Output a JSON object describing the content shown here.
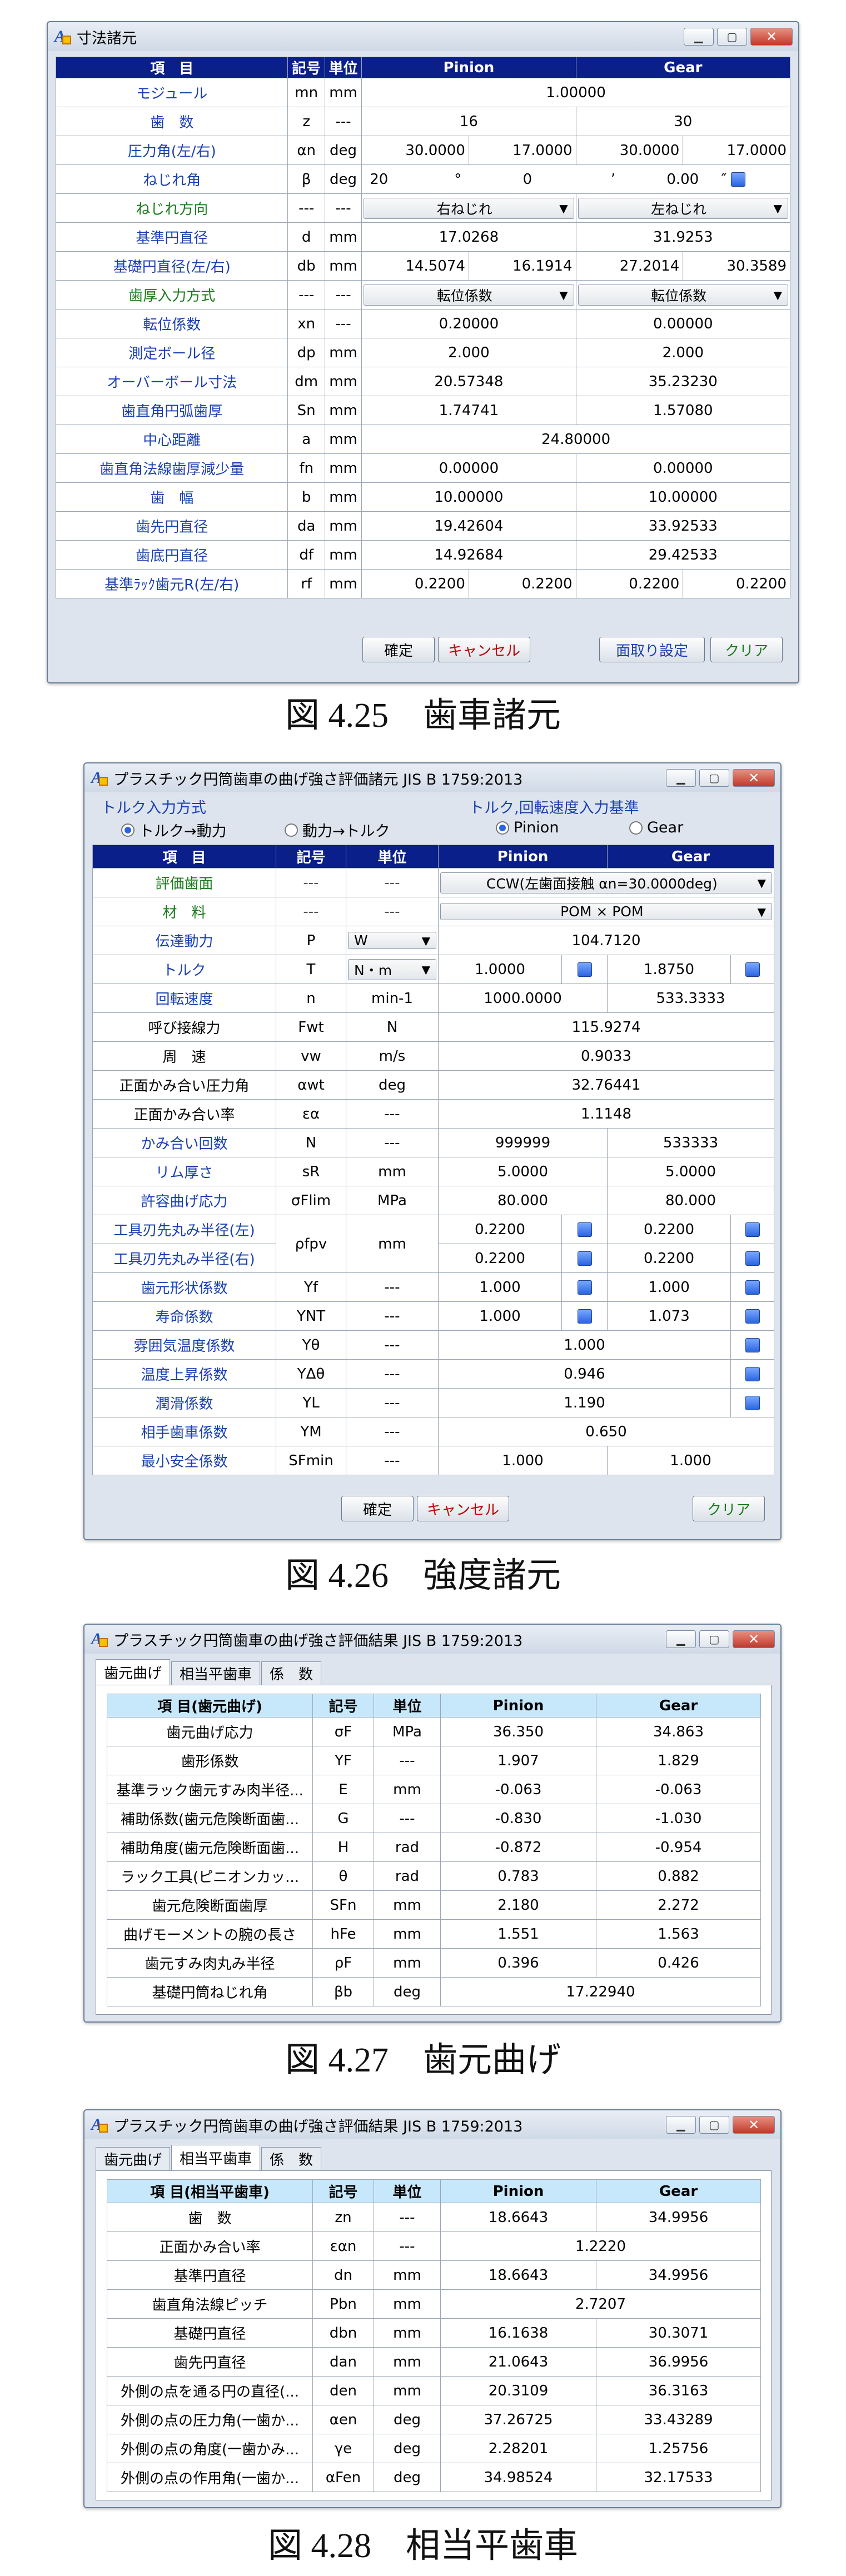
{
  "fig1": {
    "title": "寸法諸元",
    "headers": [
      "項　目",
      "記号",
      "単位",
      "Pinion",
      "Gear"
    ],
    "rows": [
      {
        "label": "モジュール",
        "sym": "mn",
        "unit": "mm",
        "span": "1.00000"
      },
      {
        "label": "歯　数",
        "sym": "z",
        "unit": "---",
        "p": "16",
        "g": "30"
      },
      {
        "label": "圧力角(左/右)",
        "sym": "αn",
        "unit": "deg",
        "p1": "30.0000",
        "p2": "17.0000",
        "g1": "30.0000",
        "g2": "17.0000"
      },
      {
        "label": "ねじれ角",
        "sym": "β",
        "unit": "deg",
        "deg": "20",
        "degmark": "°",
        "min": "0",
        "minmark": "’",
        "sec": "0.00",
        "secmark": "″"
      },
      {
        "label": "ねじれ方向",
        "sym": "---",
        "unit": "---",
        "p": "右ねじれ",
        "g": "左ねじれ"
      },
      {
        "label": "基準円直径",
        "sym": "d",
        "unit": "mm",
        "p": "17.0268",
        "g": "31.9253"
      },
      {
        "label": "基礎円直径(左/右)",
        "sym": "db",
        "unit": "mm",
        "p1": "14.5074",
        "p2": "16.1914",
        "g1": "27.2014",
        "g2": "30.3589"
      },
      {
        "label": "歯厚入力方式",
        "sym": "---",
        "unit": "---",
        "p": "転位係数",
        "g": "転位係数"
      },
      {
        "label": "転位係数",
        "sym": "xn",
        "unit": "---",
        "p": "0.20000",
        "g": "0.00000"
      },
      {
        "label": "測定ボール径",
        "sym": "dp",
        "unit": "mm",
        "p": "2.000",
        "g": "2.000"
      },
      {
        "label": "オーバーボール寸法",
        "sym": "dm",
        "unit": "mm",
        "p": "20.57348",
        "g": "35.23230"
      },
      {
        "label": "歯直角円弧歯厚",
        "sym": "Sn",
        "unit": "mm",
        "p": "1.74741",
        "g": "1.57080"
      },
      {
        "label": "中心距離",
        "sym": "a",
        "unit": "mm",
        "span": "24.80000"
      },
      {
        "label": "歯直角法線歯厚減少量",
        "sym": "fn",
        "unit": "mm",
        "p": "0.00000",
        "g": "0.00000"
      },
      {
        "label": "歯　幅",
        "sym": "b",
        "unit": "mm",
        "p": "10.00000",
        "g": "10.00000"
      },
      {
        "label": "歯先円直径",
        "sym": "da",
        "unit": "mm",
        "p": "19.42604",
        "g": "33.92533"
      },
      {
        "label": "歯底円直径",
        "sym": "df",
        "unit": "mm",
        "p": "14.92684",
        "g": "29.42533"
      },
      {
        "label": "基準ﾗｯｸ歯元R(左/右)",
        "sym": "rf",
        "unit": "mm",
        "p1": "0.2200",
        "p2": "0.2200",
        "g1": "0.2200",
        "g2": "0.2200"
      }
    ],
    "btn_ok": "確定",
    "btn_cancel": "キャンセル",
    "btn_chamfer": "面取り設定",
    "btn_clear": "クリア",
    "caption": "図 4.25　歯車諸元"
  },
  "fig2": {
    "title": "プラスチック円筒歯車の曲げ強さ評価諸元 JIS B 1759:2013",
    "group1": "トルク入力方式",
    "r1a": "トルク→動力",
    "r1b": "動力→トルク",
    "group2": "トルク,回転速度入力基準",
    "r2a": "Pinion",
    "r2b": "Gear",
    "headers": [
      "項　目",
      "記号",
      "単位",
      "Pinion",
      "Gear"
    ],
    "rows": [
      {
        "label": "評価歯面",
        "sym": "---",
        "unit": "---",
        "span": "CCW(左歯面接触 αn=30.0000deg)"
      },
      {
        "label": "材　料",
        "sym": "---",
        "unit": "---",
        "span": "POM × POM"
      },
      {
        "label": "伝達動力",
        "sym": "P",
        "unit": "W",
        "span": "104.7120"
      },
      {
        "label": "トルク",
        "sym": "T",
        "unit": "N・m",
        "p": "1.0000",
        "g": "1.8750"
      },
      {
        "label": "回転速度",
        "sym": "n",
        "unit": "min-1",
        "p": "1000.0000",
        "g": "533.3333"
      },
      {
        "label": "呼び接線力",
        "sym": "Fwt",
        "unit": "N",
        "span": "115.9274"
      },
      {
        "label": "周　速",
        "sym": "vw",
        "unit": "m/s",
        "span": "0.9033"
      },
      {
        "label": "正面かみ合い圧力角",
        "sym": "αwt",
        "unit": "deg",
        "span": "32.76441"
      },
      {
        "label": "正面かみ合い率",
        "sym": "εα",
        "unit": "---",
        "span": "1.1148"
      },
      {
        "label": "かみ合い回数",
        "sym": "N",
        "unit": "---",
        "p": "999999",
        "g": "533333"
      },
      {
        "label": "リム厚さ",
        "sym": "sR",
        "unit": "mm",
        "p": "5.0000",
        "g": "5.0000"
      },
      {
        "label": "許容曲げ応力",
        "sym": "σFlim",
        "unit": "MPa",
        "p": "80.000",
        "g": "80.000"
      },
      {
        "label": "工具刃先丸み半径(左)",
        "sym": "ρfpv",
        "unit": "mm",
        "p": "0.2200",
        "g": "0.2200"
      },
      {
        "label": "工具刃先丸み半径(右)",
        "sym": "",
        "unit": "",
        "p": "0.2200",
        "g": "0.2200"
      },
      {
        "label": "歯元形状係数",
        "sym": "Yf",
        "unit": "---",
        "p": "1.000",
        "g": "1.000"
      },
      {
        "label": "寿命係数",
        "sym": "YNT",
        "unit": "---",
        "p": "1.000",
        "g": "1.073"
      },
      {
        "label": "雰囲気温度係数",
        "sym": "Yθ",
        "unit": "---",
        "span": "1.000"
      },
      {
        "label": "温度上昇係数",
        "sym": "YΔθ",
        "unit": "---",
        "span": "0.946"
      },
      {
        "label": "潤滑係数",
        "sym": "YL",
        "unit": "---",
        "span": "1.190"
      },
      {
        "label": "相手歯車係数",
        "sym": "YM",
        "unit": "---",
        "span": "0.650"
      },
      {
        "label": "最小安全係数",
        "sym": "SFmin",
        "unit": "---",
        "p": "1.000",
        "g": "1.000"
      }
    ],
    "btn_ok": "確定",
    "btn_cancel": "キャンセル",
    "btn_clear": "クリア",
    "caption": "図 4.26　強度諸元"
  },
  "fig3": {
    "title": "プラスチック円筒歯車の曲げ強さ評価結果 JIS B 1759:2013",
    "tabs": [
      "歯元曲げ",
      "相当平歯車",
      "係　数"
    ],
    "headers": [
      "項 目(歯元曲げ)",
      "記号",
      "単位",
      "Pinion",
      "Gear"
    ],
    "rows": [
      {
        "label": "歯元曲げ応力",
        "sym": "σF",
        "unit": "MPa",
        "p": "36.350",
        "g": "34.863"
      },
      {
        "label": "歯形係数",
        "sym": "YF",
        "unit": "---",
        "p": "1.907",
        "g": "1.829"
      },
      {
        "label": "基準ラック歯元すみ肉半径...",
        "sym": "E",
        "unit": "mm",
        "p": "-0.063",
        "g": "-0.063"
      },
      {
        "label": "補助係数(歯元危険断面歯...",
        "sym": "G",
        "unit": "---",
        "p": "-0.830",
        "g": "-1.030"
      },
      {
        "label": "補助角度(歯元危険断面歯...",
        "sym": "H",
        "unit": "rad",
        "p": "-0.872",
        "g": "-0.954"
      },
      {
        "label": "ラック工具(ピニオンカッ...",
        "sym": "θ",
        "unit": "rad",
        "p": "0.783",
        "g": "0.882"
      },
      {
        "label": "歯元危険断面歯厚",
        "sym": "SFn",
        "unit": "mm",
        "p": "2.180",
        "g": "2.272"
      },
      {
        "label": "曲げモーメントの腕の長さ",
        "sym": "hFe",
        "unit": "mm",
        "p": "1.551",
        "g": "1.563"
      },
      {
        "label": "歯元すみ肉丸み半径",
        "sym": "ρF",
        "unit": "mm",
        "p": "0.396",
        "g": "0.426"
      },
      {
        "label": "基礎円筒ねじれ角",
        "sym": "βb",
        "unit": "deg",
        "span": "17.22940"
      }
    ],
    "caption": "図 4.27　歯元曲げ"
  },
  "fig4": {
    "title": "プラスチック円筒歯車の曲げ強さ評価結果 JIS B 1759:2013",
    "tabs": [
      "歯元曲げ",
      "相当平歯車",
      "係　数"
    ],
    "headers": [
      "項 目(相当平歯車)",
      "記号",
      "単位",
      "Pinion",
      "Gear"
    ],
    "rows": [
      {
        "label": "歯　数",
        "sym": "zn",
        "unit": "---",
        "p": "18.6643",
        "g": "34.9956"
      },
      {
        "label": "正面かみ合い率",
        "sym": "εαn",
        "unit": "---",
        "span": "1.2220"
      },
      {
        "label": "基準円直径",
        "sym": "dn",
        "unit": "mm",
        "p": "18.6643",
        "g": "34.9956"
      },
      {
        "label": "歯直角法線ピッチ",
        "sym": "Pbn",
        "unit": "mm",
        "span": "2.7207"
      },
      {
        "label": "基礎円直径",
        "sym": "dbn",
        "unit": "mm",
        "p": "16.1638",
        "g": "30.3071"
      },
      {
        "label": "歯先円直径",
        "sym": "dan",
        "unit": "mm",
        "p": "21.0643",
        "g": "36.9956"
      },
      {
        "label": "外側の点を通る円の直径(...",
        "sym": "den",
        "unit": "mm",
        "p": "20.3109",
        "g": "36.3163"
      },
      {
        "label": "外側の点の圧力角(一歯か...",
        "sym": "αen",
        "unit": "deg",
        "p": "37.26725",
        "g": "33.43289"
      },
      {
        "label": "外側の点の角度(一歯かみ...",
        "sym": "γe",
        "unit": "deg",
        "p": "2.28201",
        "g": "1.25756"
      },
      {
        "label": "外側の点の作用角(一歯か...",
        "sym": "αFen",
        "unit": "deg",
        "p": "34.98524",
        "g": "32.17533"
      }
    ],
    "caption": "図 4.28　相当平歯車"
  }
}
